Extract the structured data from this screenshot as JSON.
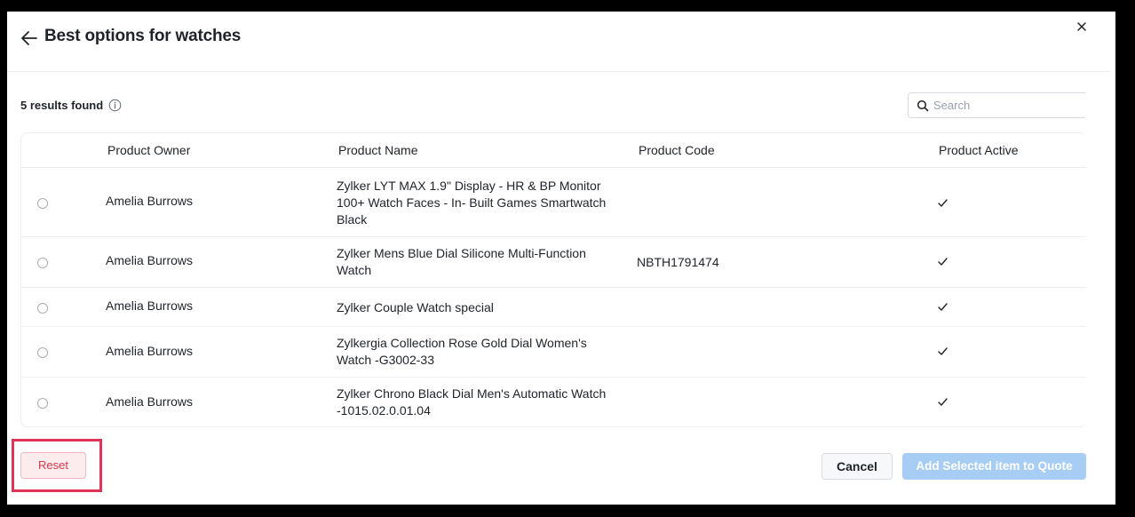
{
  "header": {
    "title": "Best options for watches",
    "back_icon": "arrow-left-icon",
    "close_icon": "close-icon"
  },
  "summary": {
    "results_text": "5 results found",
    "info_icon": "info-icon"
  },
  "search": {
    "placeholder": "Search",
    "value": "",
    "icon": "search-icon"
  },
  "table": {
    "columns": [
      "Product Owner",
      "Product Name",
      "Product Code",
      "Product Active"
    ],
    "rows": [
      {
        "owner": "Amelia Burrows",
        "name_lines": [
          "Zylker LYT MAX 1.9\" Display - HR & BP Monitor",
          "100+ Watch Faces - In- Built Games Smartwatch",
          "Black"
        ],
        "code": "",
        "active": "✓"
      },
      {
        "owner": "Amelia Burrows",
        "name_lines": [
          "Zylker Mens Blue Dial Silicone Multi-Function",
          "Watch"
        ],
        "code": "NBTH1791474",
        "active": "✓"
      },
      {
        "owner": "Amelia Burrows",
        "name_lines": [
          "Zylker Couple Watch special"
        ],
        "code": "",
        "active": "✓"
      },
      {
        "owner": "Amelia Burrows",
        "name_lines": [
          "Zylkergia Collection Rose Gold Dial Women's",
          "Watch -G3002-33"
        ],
        "code": "",
        "active": "✓"
      },
      {
        "owner": "Amelia Burrows",
        "name_lines": [
          "Zylker Chrono Black Dial Men's Automatic Watch",
          "-1015.02.0.01.04"
        ],
        "code": "",
        "active": "✓"
      }
    ]
  },
  "footer": {
    "reset_label": "Reset",
    "cancel_label": "Cancel",
    "add_label": "Add Selected item to Quote"
  },
  "colors": {
    "primary_disabled": "#a8cdf4",
    "reset_text": "#d8374b",
    "highlight": "#e0335a"
  }
}
